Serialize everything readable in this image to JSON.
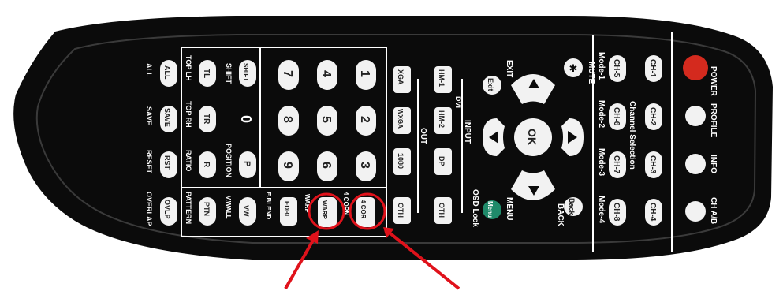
{
  "remote": {
    "top_row": {
      "power": "POWER",
      "profile": "PROFILE",
      "info": "INFO",
      "ch_ab": "CH A/B"
    },
    "channels": [
      "CH-1",
      "CH-2",
      "CH-3",
      "CH-4",
      "CH-5",
      "CH-6",
      "CH-7",
      "CH-8"
    ],
    "channel_selection": "Channel Selection",
    "modes": [
      "Mode-1",
      "Mode-2",
      "Mode-3",
      "Mode-4"
    ],
    "mute": "MUTE",
    "exit_label": "EXIT",
    "exit_button": "Exit",
    "ok": "OK",
    "back_label": "BACK",
    "back_button": "Back",
    "menu_label": "MENU",
    "menu_button": "Menu",
    "osd_lock": "OSD Lock",
    "input_label": "INPUT",
    "input": {
      "hm1": "HM-1",
      "dvi": "DVI",
      "hm2": "HM-2",
      "dp": "DP",
      "oth": "OTH"
    },
    "out_label": "OUT",
    "out": {
      "xga": "XGA",
      "wxga": "WXGA",
      "p1080": "1080",
      "oth": "OTH"
    },
    "numbers": [
      "1",
      "2",
      "3",
      "4",
      "5",
      "6",
      "7",
      "8",
      "9",
      "0"
    ],
    "shift_button": "SHIFT",
    "shift_label": "SHIFT",
    "p_button": "P",
    "position_label": "POSITION",
    "four_cor_button": "4 COR",
    "four_corn_label": "4 CORN",
    "warp_button": "WARP",
    "warp_label": "WARP",
    "edbl_button": "EDBL",
    "eblend_label": "E.BLEND",
    "vw_button": "VW",
    "vwall_label": "V.WALL",
    "tl_button": "TL",
    "toplh_label": "TOP LH",
    "tr_button": "TR",
    "toprh_label": "TOP RH",
    "r_button": "R",
    "ratio_label": "RATIO",
    "ptn_button": "PTN",
    "pattern_label": "PATTERN",
    "all_button": "ALL",
    "all_label": "ALL",
    "save_button": "SAVE",
    "save_label": "SAVE",
    "rst_button": "RST",
    "reset_label": "RESET",
    "ovlp_button": "OVLP",
    "overlap_label": "OVERLAP"
  },
  "annotation": {
    "circle_color": "#e0121b",
    "arrow_color": "#e0121b",
    "targets": [
      "WARP",
      "4 COR"
    ]
  },
  "colors": {
    "body": "#0b0b0b",
    "power": "#d42a1e",
    "menu": "#1f8a6a",
    "button": "#f2f2f2"
  }
}
